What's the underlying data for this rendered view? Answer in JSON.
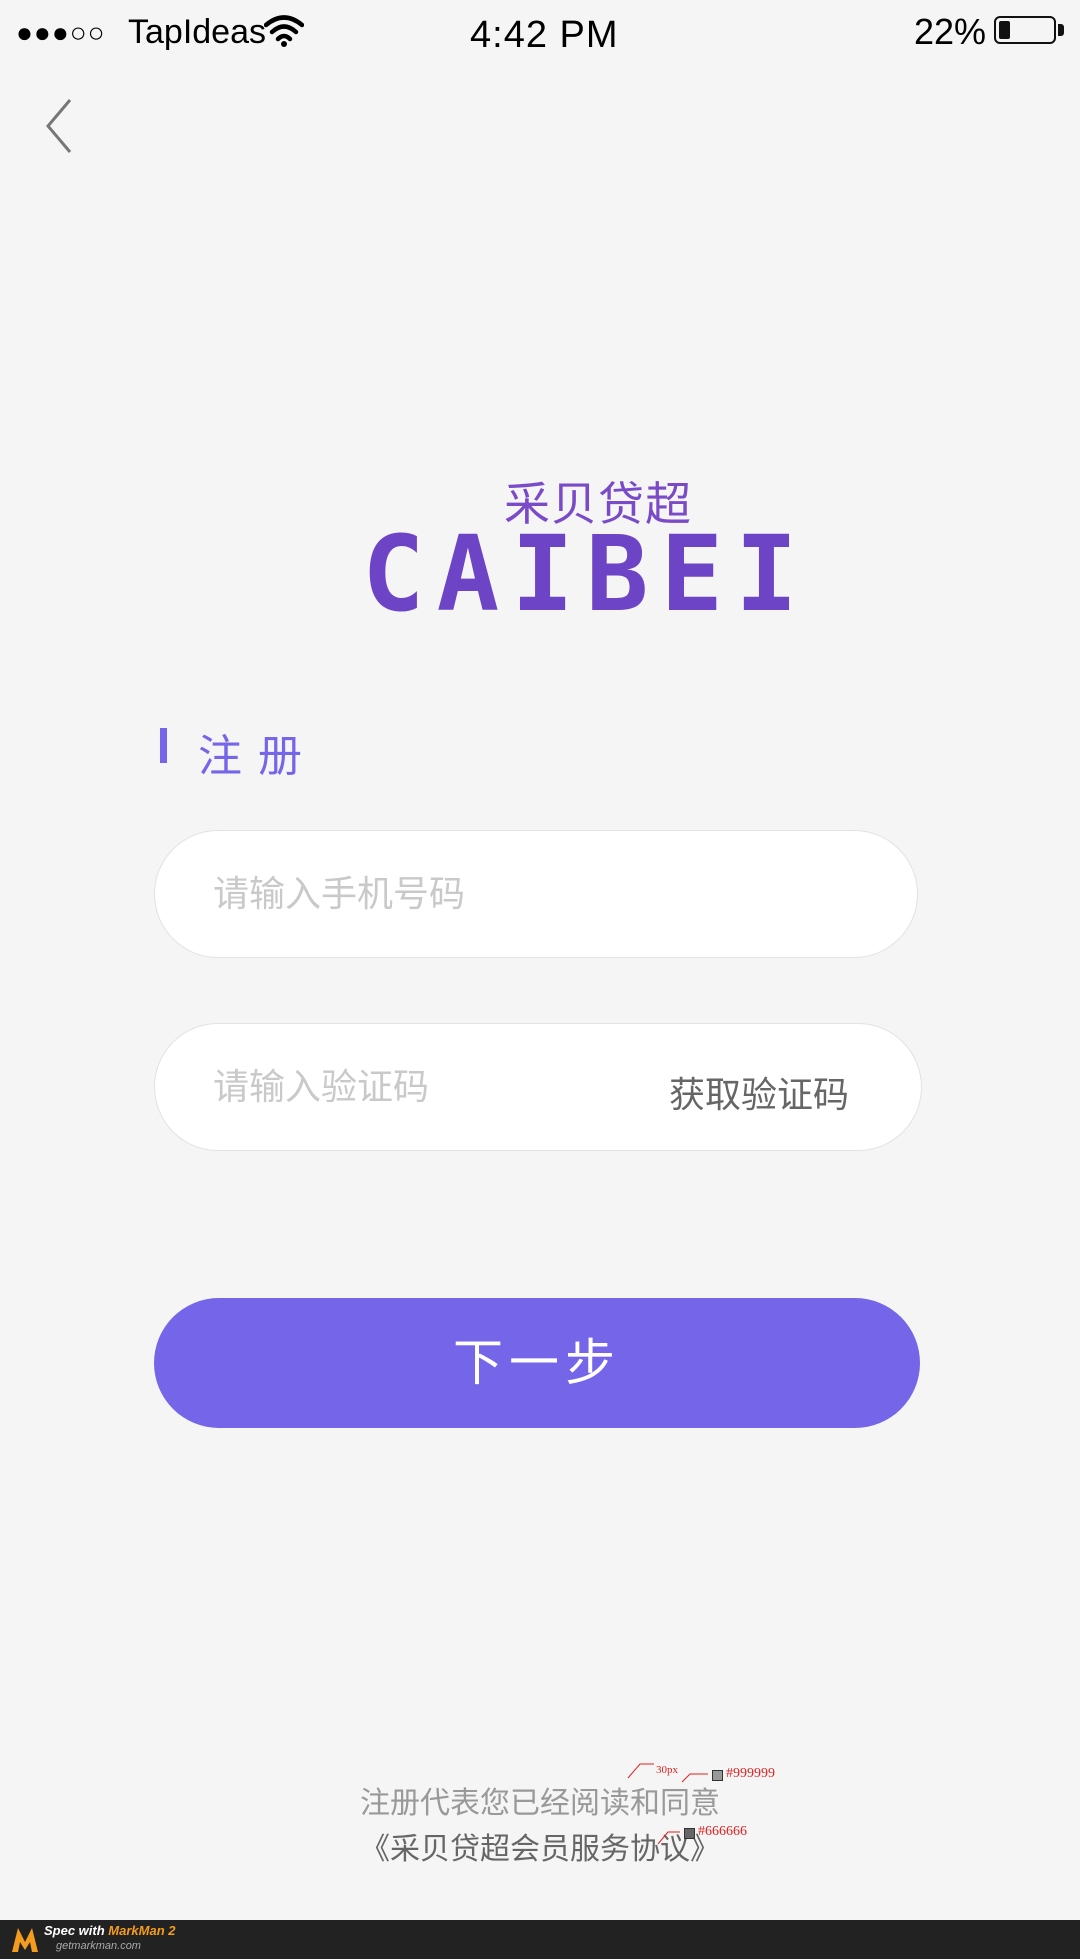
{
  "status_bar": {
    "signal": "●●●○○",
    "carrier": "TapIdeas",
    "time": "4:42 PM",
    "battery_percent": "22%",
    "battery_level": 0.22
  },
  "logo": {
    "chinese": "采贝贷超",
    "english": "CAIBEI",
    "color": "#6d44c6"
  },
  "section": {
    "title": "注册"
  },
  "form": {
    "phone_placeholder": "请输入手机号码",
    "code_placeholder": "请输入验证码",
    "get_code_label": "获取验证码",
    "next_label": "下一步"
  },
  "agreement": {
    "line1": "注册代表您已经阅读和同意",
    "line2": "《采贝贷超会员服务协议》"
  },
  "spec_annotations": {
    "size": "30px",
    "color1": "#999999",
    "color2": "#666666"
  },
  "footer": {
    "spec_prefix": "Spec with ",
    "brand": "MarkMan 2",
    "url": "getmarkman.com"
  },
  "colors": {
    "accent": "#7565e8",
    "background": "#f5f5f5"
  }
}
